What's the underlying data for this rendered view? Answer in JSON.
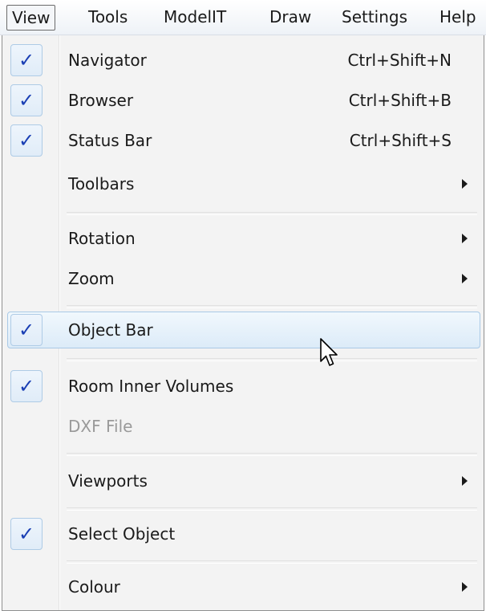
{
  "menubar": {
    "items": [
      "View",
      "Tools",
      "ModelIT",
      "Draw",
      "Settings",
      "Help"
    ]
  },
  "menu": {
    "items": [
      {
        "label": "Navigator",
        "shortcut": "Ctrl+Shift+N",
        "checked": true
      },
      {
        "label": "Browser",
        "shortcut": "Ctrl+Shift+B",
        "checked": true
      },
      {
        "label": "Status Bar",
        "shortcut": "Ctrl+Shift+S",
        "checked": true
      },
      {
        "label": "Toolbars",
        "submenu": true
      },
      {
        "label": "Rotation",
        "submenu": true
      },
      {
        "label": "Zoom",
        "submenu": true
      },
      {
        "label": "Object Bar",
        "checked": true,
        "hovered": true
      },
      {
        "label": "Room Inner Volumes",
        "checked": true
      },
      {
        "label": "DXF File",
        "disabled": true
      },
      {
        "label": "Viewports",
        "submenu": true
      },
      {
        "label": "Select Object",
        "checked": true
      },
      {
        "label": "Colour",
        "submenu": true
      }
    ]
  },
  "icons": {
    "check": "✓",
    "submenu_arrow": "submenu-arrow-icon",
    "cursor": "mouse-pointer-icon"
  },
  "colors": {
    "check": "#1a3fb4",
    "hover_border": "#a9c9e6",
    "disabled_text": "#9a9a9a"
  }
}
